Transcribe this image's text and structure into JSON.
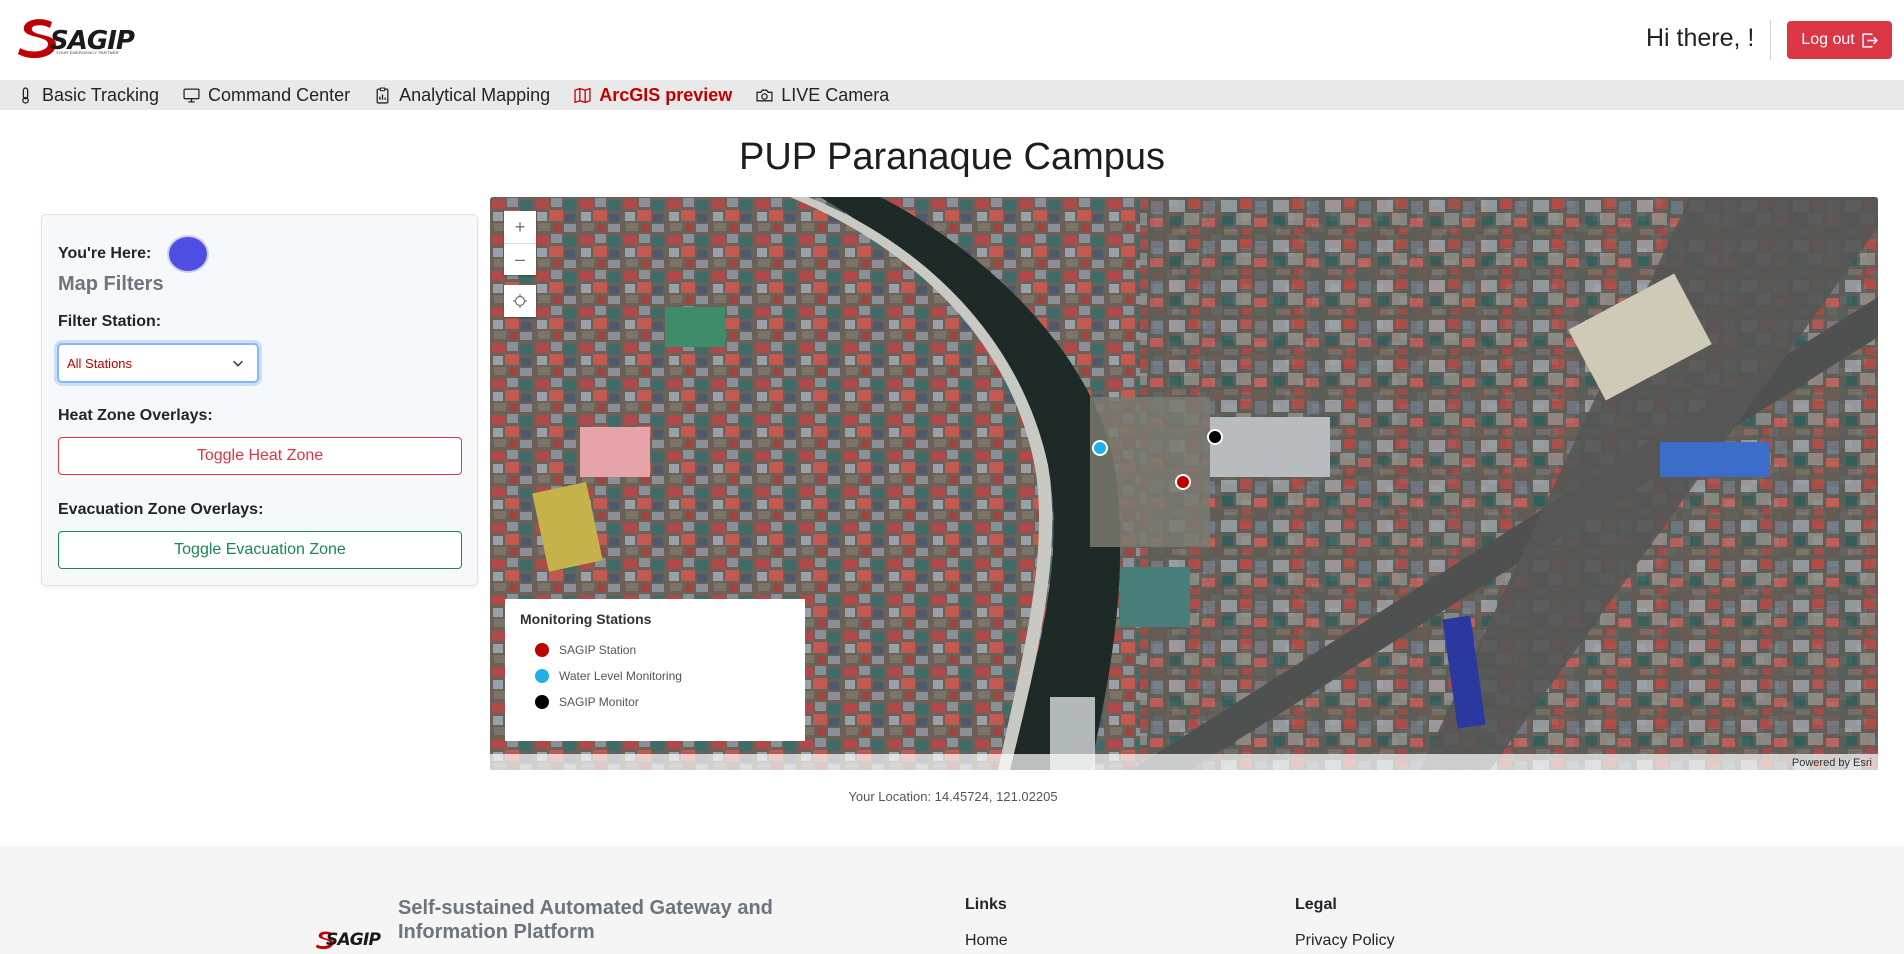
{
  "header": {
    "logo_text": "SAGIP",
    "logo_tagline": "YOUR EMERGENCY PARTNER",
    "greeting": "Hi there, !",
    "logout_label": "Log out",
    "colors": {
      "brand_red": "#c00000",
      "logout": "#dc3545"
    }
  },
  "nav": {
    "items": [
      {
        "label": "Basic Tracking",
        "icon": "thermometer-icon",
        "active": false
      },
      {
        "label": "Command Center",
        "icon": "monitor-icon",
        "active": false
      },
      {
        "label": "Analytical Mapping",
        "icon": "clipboard-data-icon",
        "active": false
      },
      {
        "label": "ArcGIS preview",
        "icon": "map-icon",
        "active": true
      },
      {
        "label": "LIVE Camera",
        "icon": "camera-icon",
        "active": false
      }
    ]
  },
  "page": {
    "title": "PUP Paranaque Campus"
  },
  "filters": {
    "you_here_label": "You're Here:",
    "title": "Map Filters",
    "station_label": "Filter Station:",
    "station_selected": "All Stations",
    "heat_label": "Heat Zone Overlays:",
    "heat_button": "Toggle Heat Zone",
    "evac_label": "Evacuation Zone Overlays:",
    "evac_button": "Toggle Evacuation Zone"
  },
  "map": {
    "zoom_in": "+",
    "zoom_out": "–",
    "legend": {
      "title": "Monitoring Stations",
      "items": [
        {
          "label": "SAGIP Station",
          "color": "#c00000"
        },
        {
          "label": "Water Level Monitoring",
          "color": "#1fb0ea"
        },
        {
          "label": "SAGIP Monitor",
          "color": "#000000"
        }
      ]
    },
    "credit": "Powered by Esri"
  },
  "location": {
    "text": "Your Location: 14.45724, 121.02205"
  },
  "footer": {
    "logo_text": "SAGIP",
    "brand": "Self-sustained Automated Gateway and Information Platform",
    "links_title": "Links",
    "links": [
      "Home"
    ],
    "legal_title": "Legal",
    "legal": [
      "Privacy Policy"
    ]
  }
}
